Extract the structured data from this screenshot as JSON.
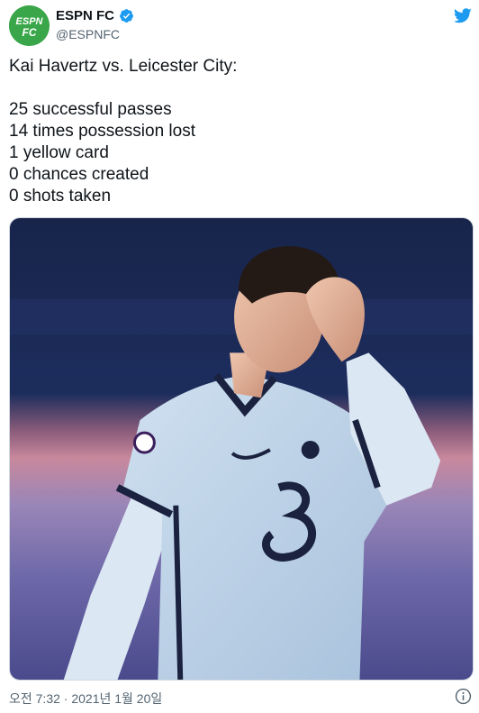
{
  "account": {
    "display_name": "ESPN FC",
    "handle": "@ESPNFC",
    "avatar_text_top": "ESPN",
    "avatar_text_bottom": "FC",
    "verified": true,
    "avatar_color": "#3aa64a"
  },
  "tweet": {
    "lines": [
      "Kai Havertz vs. Leicester City:",
      "",
      "25 successful passes",
      "14 times possession lost",
      "1 yellow card",
      "0 chances created",
      "0 shots taken"
    ],
    "timestamp": "오전 7:32 · 2021년 1월 20일"
  },
  "icons": {
    "brand": "twitter-bird-icon",
    "verified": "verified-badge-icon",
    "info": "info-icon"
  },
  "colors": {
    "twitter_blue": "#1d9bf0",
    "muted_text": "#536471"
  }
}
